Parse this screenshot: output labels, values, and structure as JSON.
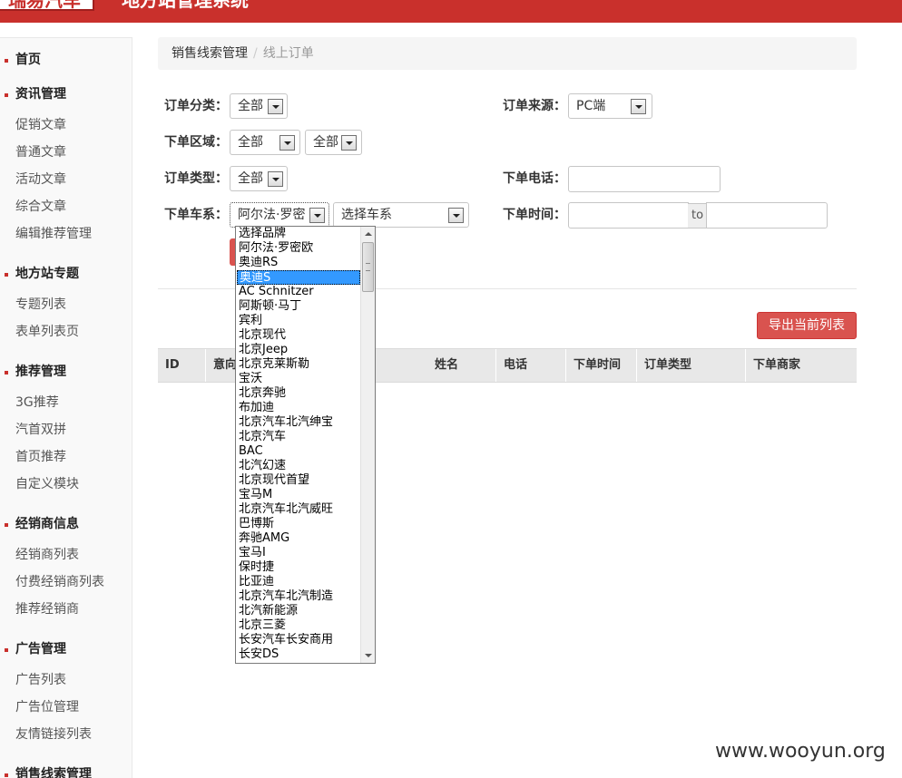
{
  "header": {
    "logo_text": "瑞易汽车",
    "system_title": "地方站管理系统"
  },
  "sidebar": {
    "groups": [
      {
        "title": "首页",
        "items": []
      },
      {
        "title": "资讯管理",
        "items": [
          "促销文章",
          "普通文章",
          "活动文章",
          "综合文章",
          "编辑推荐管理"
        ]
      },
      {
        "title": "地方站专题",
        "items": [
          "专题列表",
          "表单列表页"
        ]
      },
      {
        "title": "推荐管理",
        "items": [
          "3G推荐",
          "汽首双拼",
          "首页推荐",
          "自定义模块"
        ]
      },
      {
        "title": "经销商信息",
        "items": [
          "经销商列表",
          "付费经销商列表",
          "推荐经销商"
        ]
      },
      {
        "title": "广告管理",
        "items": [
          "广告列表",
          "广告位管理",
          "友情链接列表"
        ]
      },
      {
        "title": "销售线索管理",
        "items": []
      }
    ]
  },
  "breadcrumb": {
    "parent": "销售线索管理",
    "separator": "/",
    "current": "线上订单"
  },
  "filters": {
    "order_category": {
      "label": "订单分类：",
      "value": "全部"
    },
    "order_source": {
      "label": "订单来源：",
      "value": "PC端"
    },
    "order_region": {
      "label": "下单区域：",
      "province": "全部",
      "city": "全部"
    },
    "order_type": {
      "label": "订单类型：",
      "value": "全部"
    },
    "order_phone": {
      "label": "下单电话：",
      "value": ""
    },
    "order_series": {
      "label": "下单车系：",
      "brand_value": "阿尔法·罗密",
      "series_value": "选择车系"
    },
    "order_time": {
      "label": "下单时间：",
      "from": "",
      "to_label": "to",
      "to": ""
    }
  },
  "actions": {
    "export_label": "导出当前列表"
  },
  "table": {
    "columns": [
      "ID",
      "意向",
      "姓名",
      "电话",
      "下单时间",
      "订单类型",
      "下单商家"
    ]
  },
  "brand_dropdown": {
    "selected_index": 3,
    "options": [
      "选择品牌",
      "阿尔法·罗密欧",
      "奥迪RS",
      "奥迪S",
      "AC Schnitzer",
      "阿斯顿·马丁",
      "宾利",
      "北京现代",
      "北京Jeep",
      "北京克莱斯勒",
      "宝沃",
      "北京奔驰",
      "布加迪",
      "北京汽车北汽绅宝",
      "北京汽车",
      "BAC",
      "北汽幻速",
      "北京现代首望",
      "宝马M",
      "北京汽车北汽威旺",
      "巴博斯",
      "奔驰AMG",
      "宝马I",
      "保时捷",
      "比亚迪",
      "北京汽车北汽制造",
      "北汽新能源",
      "北京三菱",
      "长安汽车长安商用",
      "长安DS"
    ]
  },
  "watermark": "www.wooyun.org"
}
